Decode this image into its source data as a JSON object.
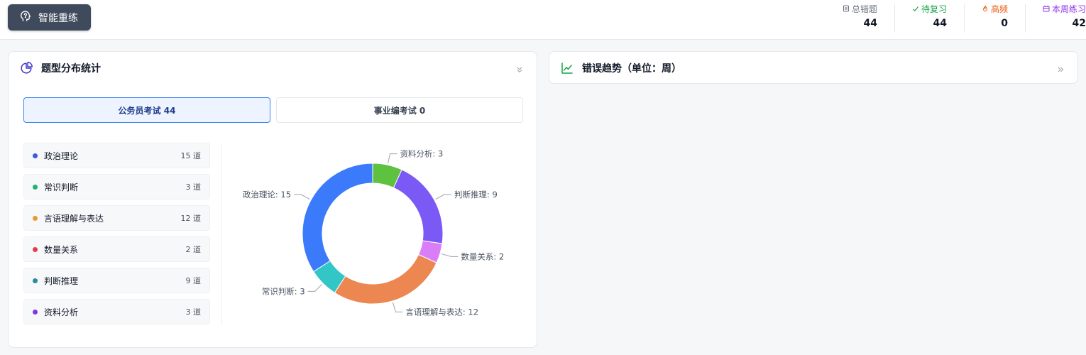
{
  "header": {
    "retrain_label": "智能重练",
    "stats": [
      {
        "label": "总错题",
        "value": "44",
        "color": "#6b7280",
        "icon": "document-icon"
      },
      {
        "label": "待复习",
        "value": "44",
        "color": "#16a34a",
        "icon": "check-icon"
      },
      {
        "label": "高频",
        "value": "0",
        "color": "#ea580c",
        "icon": "fire-icon"
      },
      {
        "label": "本周练习",
        "value": "42",
        "color": "#9333ea",
        "icon": "calendar-icon"
      }
    ]
  },
  "distribution": {
    "title": "题型分布统计",
    "tabs": [
      {
        "label": "公务员考试 44",
        "active": true
      },
      {
        "label": "事业编考试 0",
        "active": false
      }
    ],
    "categories": [
      {
        "name": "政治理论",
        "count": "15 道",
        "dot": "#3b5bdb"
      },
      {
        "name": "常识判断",
        "count": "3 道",
        "dot": "#20b27a"
      },
      {
        "name": "言语理解与表达",
        "count": "12 道",
        "dot": "#ea9a2e"
      },
      {
        "name": "数量关系",
        "count": "2 道",
        "dot": "#e03e4e"
      },
      {
        "name": "判断推理",
        "count": "9 道",
        "dot": "#2a8a9e"
      },
      {
        "name": "资料分析",
        "count": "3 道",
        "dot": "#7e3ae0"
      }
    ]
  },
  "trend": {
    "title": "错误趋势（单位：周）"
  },
  "chart_data": {
    "type": "pie",
    "donut": true,
    "slices": [
      {
        "label": "资料分析: 3",
        "name": "资料分析",
        "value": 3,
        "color": "#5ec13f"
      },
      {
        "label": "判断推理: 9",
        "name": "判断推理",
        "value": 9,
        "color": "#7b59f5"
      },
      {
        "label": "数量关系: 2",
        "name": "数量关系",
        "value": 2,
        "color": "#d97ef7"
      },
      {
        "label": "言语理解与表达: 12",
        "name": "言语理解与表达",
        "value": 12,
        "color": "#ec8752"
      },
      {
        "label": "常识判断: 3",
        "name": "常识判断",
        "value": 3,
        "color": "#33c6c6"
      },
      {
        "label": "政治理论: 15",
        "name": "政治理论",
        "value": 15,
        "color": "#3b7bfb"
      }
    ]
  }
}
